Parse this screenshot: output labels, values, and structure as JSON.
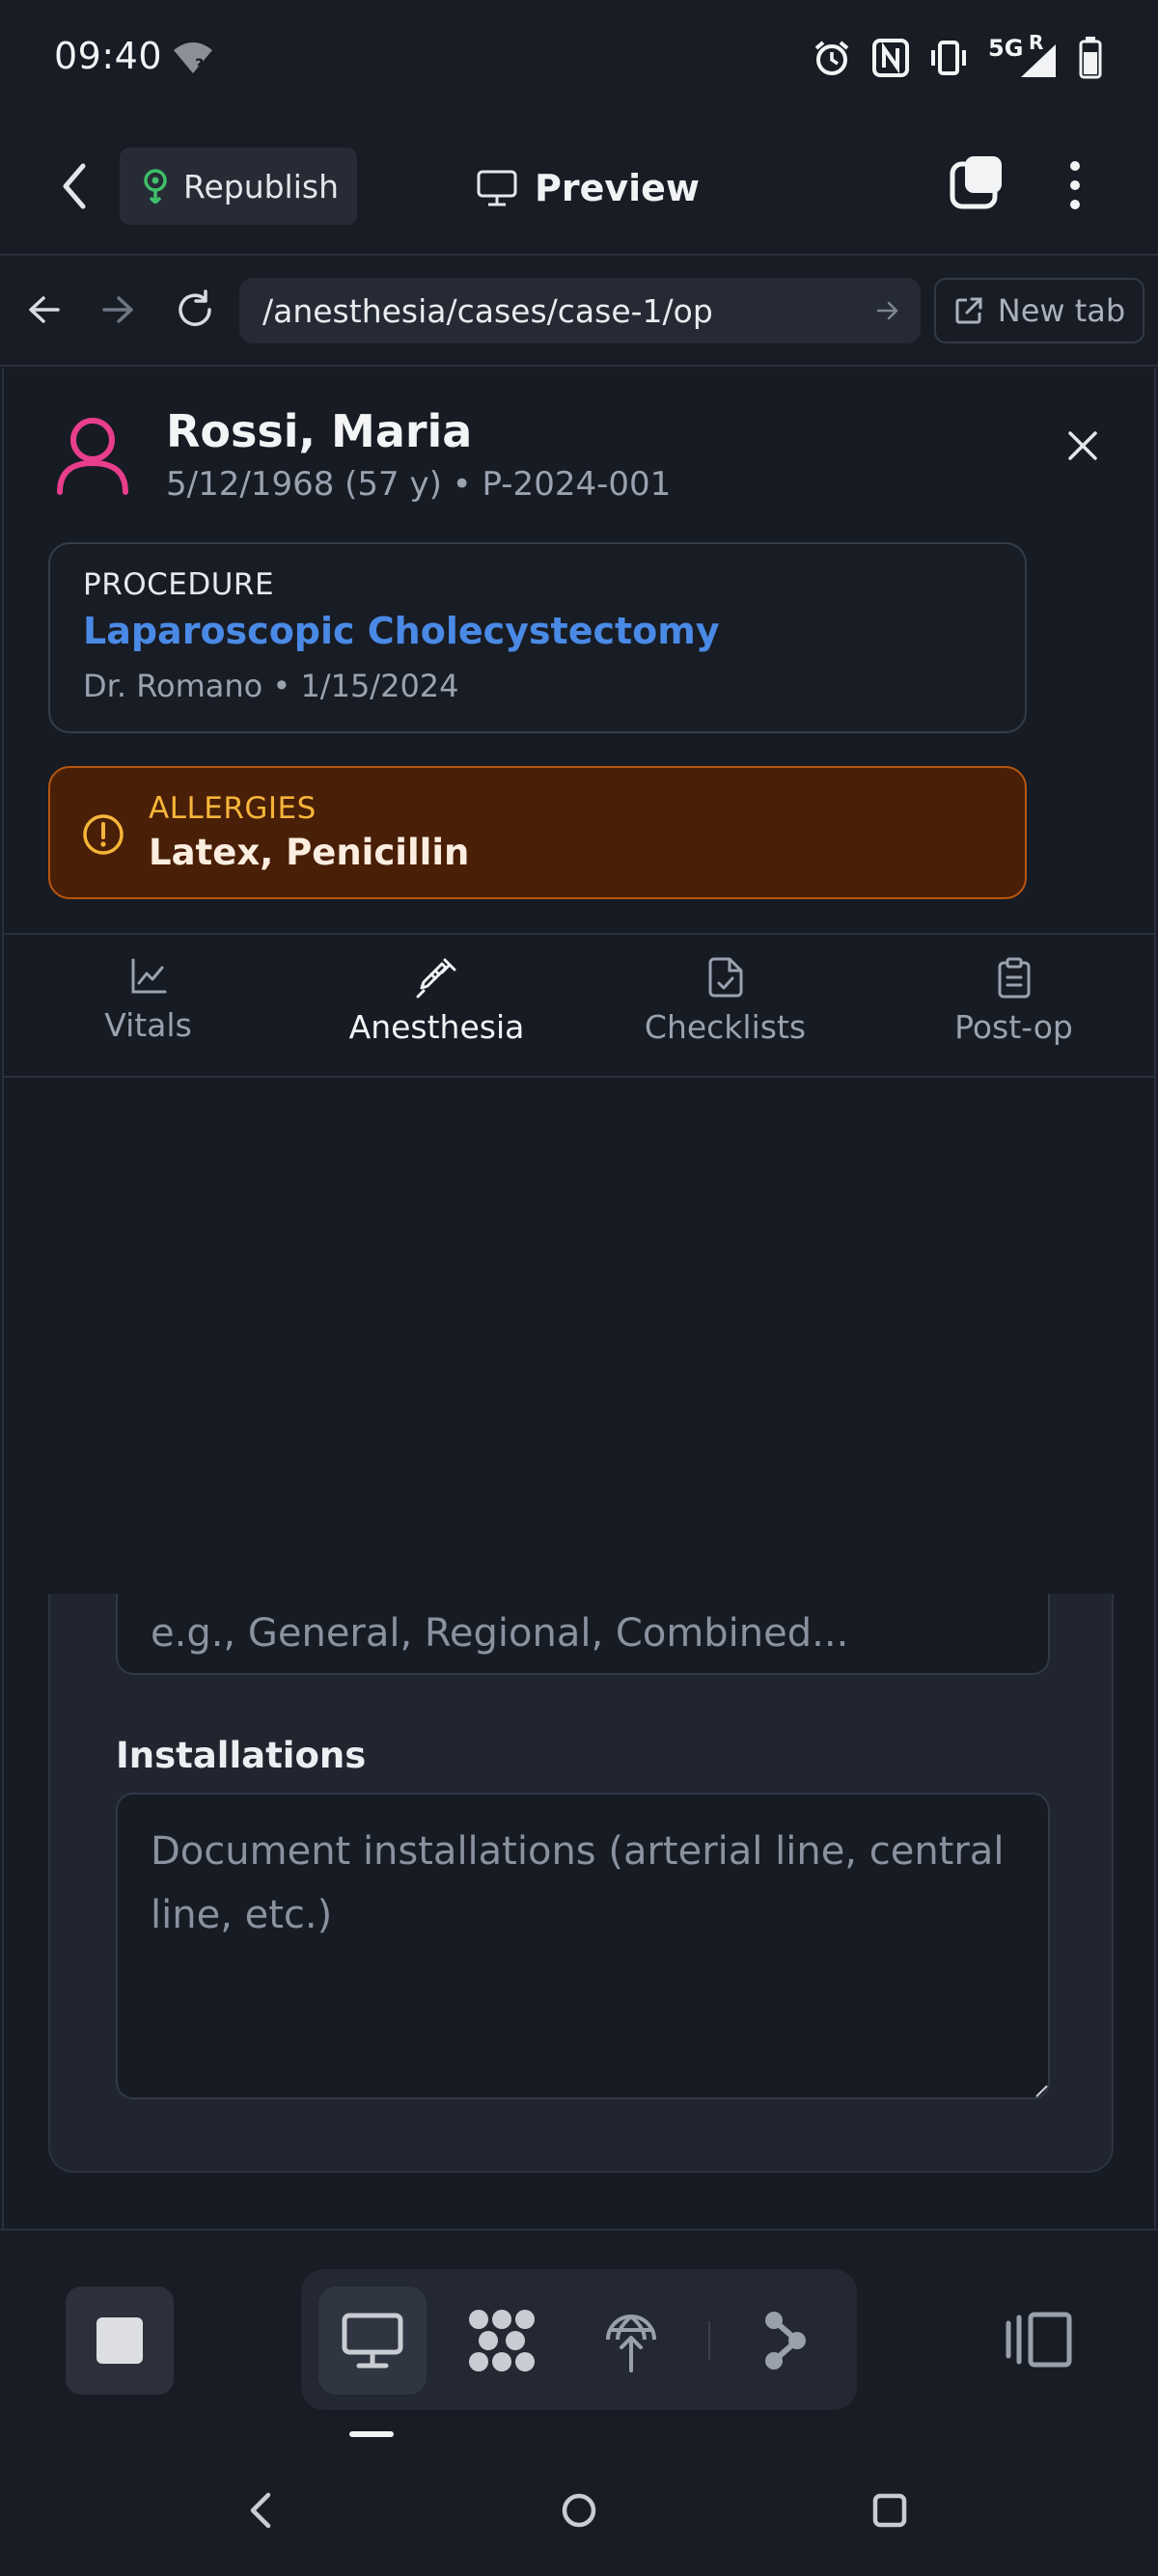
{
  "status_bar": {
    "time": "09:40",
    "network": "5G",
    "roaming": "R"
  },
  "header": {
    "republish_label": "Republish",
    "preview_label": "Preview"
  },
  "browser": {
    "url": "/anesthesia/cases/case-1/op",
    "new_tab_label": "New tab"
  },
  "patient": {
    "name": "Rossi, Maria",
    "meta": "5/12/1968 (57 y) • P-2024-001"
  },
  "procedure": {
    "label": "PROCEDURE",
    "name": "Laparoscopic Cholecystectomy",
    "details": "Dr. Romano • 1/15/2024"
  },
  "allergies": {
    "label": "ALLERGIES",
    "value": "Latex, Penicillin"
  },
  "tabs": [
    {
      "label": "Vitals",
      "icon": "chart-line-icon",
      "active": false
    },
    {
      "label": "Anesthesia",
      "icon": "syringe-icon",
      "active": true
    },
    {
      "label": "Checklists",
      "icon": "file-check-icon",
      "active": false
    },
    {
      "label": "Post-op",
      "icon": "clipboard-icon",
      "active": false
    }
  ],
  "form": {
    "anesthesia_type_placeholder": "e.g., General, Regional, Combined...",
    "installations_label": "Installations",
    "installations_placeholder": "Document installations (arterial line, central line, etc.)"
  },
  "colors": {
    "background": "#181c25",
    "accent_blue": "#4a8ae6",
    "avatar_pink": "#e83e8c",
    "allergy_bg": "#4a1f07",
    "allergy_border": "#b8560f",
    "allergy_text": "#f6b53a"
  }
}
